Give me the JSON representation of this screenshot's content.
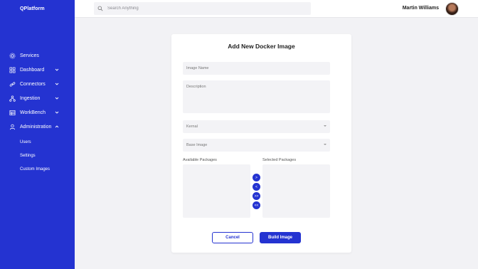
{
  "sidebar": {
    "brand": "QPlatform",
    "items": [
      {
        "label": "Services",
        "icon": "gear-icon"
      },
      {
        "label": "Dashboard",
        "icon": "grid-icon"
      },
      {
        "label": "Connectors",
        "icon": "link-icon"
      },
      {
        "label": "Ingestion",
        "icon": "hierarchy-icon"
      },
      {
        "label": "WorkBench",
        "icon": "table-icon"
      },
      {
        "label": "Administration",
        "icon": "user-icon"
      }
    ],
    "subitems": [
      "Users",
      "Settings",
      "Custom Images"
    ]
  },
  "topbar": {
    "search_placeholder": "Search Anything",
    "user_name": "Martin Williams"
  },
  "form": {
    "title": "Add New Docker Image",
    "image_name_placeholder": "Image Name",
    "description_placeholder": "Description",
    "kernal_label": "Kernal",
    "base_image_label": "Base Image",
    "available_label": "Available Packages",
    "selected_label": "Selected Packages",
    "move_buttons": [
      ">",
      "<",
      ">>",
      "<<"
    ],
    "cancel_label": "Cancel",
    "build_label": "Build Image"
  },
  "colors": {
    "accent": "#2433d1",
    "background": "#f2f2f5"
  }
}
